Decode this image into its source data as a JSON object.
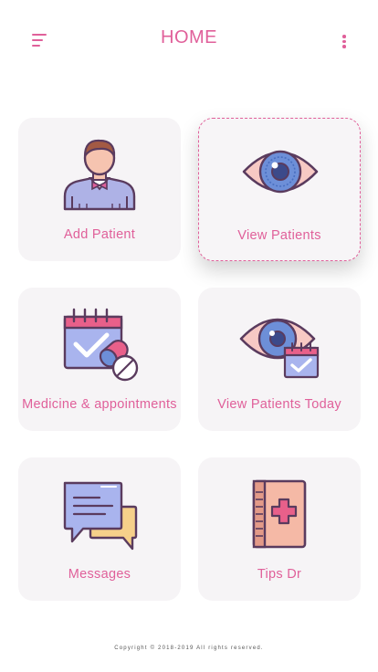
{
  "header": {
    "title": "HOME",
    "menu_icon": "hamburger-menu-icon",
    "more_icon": "more-vertical-icon"
  },
  "accent_color": "#e0609a",
  "cards": [
    {
      "label": "Add  Patient",
      "icon": "doctor-person-icon"
    },
    {
      "label": "View Patients",
      "icon": "eye-icon",
      "selected": true
    },
    {
      "label": "Medicine & appointments",
      "icon": "calendar-pills-icon"
    },
    {
      "label": "View Patients Today",
      "icon": "eye-calendar-icon"
    },
    {
      "label": "Messages",
      "icon": "chat-bubbles-icon"
    },
    {
      "label": "Tips Dr",
      "icon": "medical-book-icon"
    }
  ],
  "footer": {
    "copyright": "Copyright © 2018-2019 All rights reserved."
  }
}
